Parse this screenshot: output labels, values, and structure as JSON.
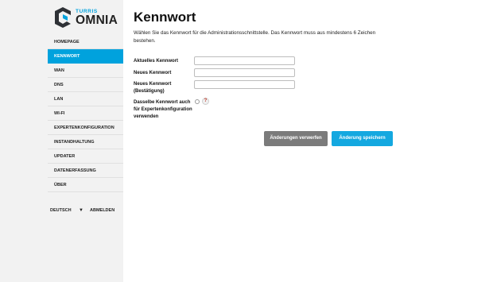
{
  "logo": {
    "small": "TURRIS",
    "big": "OMNIA"
  },
  "nav": {
    "items": [
      {
        "label": "HOMEPAGE",
        "active": false
      },
      {
        "label": "KENNWORT",
        "active": true
      },
      {
        "label": "WAN",
        "active": false
      },
      {
        "label": "DNS",
        "active": false
      },
      {
        "label": "LAN",
        "active": false
      },
      {
        "label": "WI-FI",
        "active": false
      },
      {
        "label": "EXPERTENKONFIGURATION",
        "active": false
      },
      {
        "label": "INSTANDHALTUNG",
        "active": false
      },
      {
        "label": "UPDATER",
        "active": false
      },
      {
        "label": "DATENERFASSUNG",
        "active": false
      },
      {
        "label": "ÜBER",
        "active": false
      }
    ]
  },
  "footer": {
    "language": "DEUTSCH",
    "caret": "▼",
    "logout": "ABMELDEN"
  },
  "page": {
    "title": "Kennwort",
    "description": "Wählen Sie das Kennwort für die Administrationsschnittstelle. Das Kennwort muss aus mindestens 6 Zeichen bestehen."
  },
  "form": {
    "current_password": {
      "label": "Aktuelles Kennwort",
      "value": ""
    },
    "new_password": {
      "label": "Neues Kennwort",
      "value": ""
    },
    "confirm_password": {
      "label": "Neues Kennwort (Bestätigung)",
      "value": ""
    },
    "same_for_expert": {
      "label": "Dasselbe Kennwort auch für Expertenkonfiguration verwenden",
      "checked": false,
      "help": "?"
    }
  },
  "buttons": {
    "discard": "Änderungen verwerfen",
    "save": "Änderung speichern"
  },
  "colors": {
    "accent": "#00a2dd",
    "discard": "#7b7b7b",
    "save": "#14a8e0"
  },
  "icons": {
    "logo": "turris-logo-icon",
    "help": "help-icon",
    "caret": "caret-down-icon"
  }
}
